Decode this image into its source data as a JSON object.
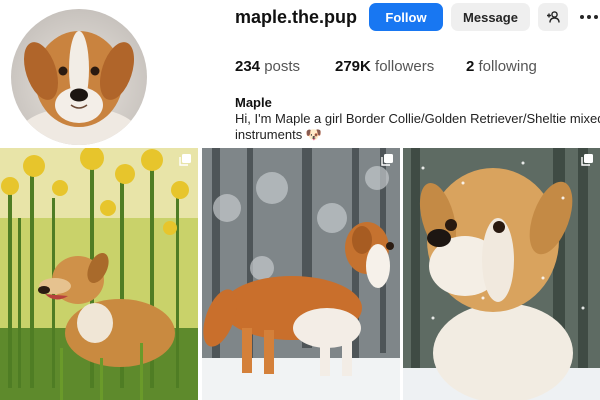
{
  "profile": {
    "username": "maple.the.pup",
    "display_name": "Maple",
    "bio_line1": "Hi, I'm Maple a girl Border Collie/Golden Retriever/Sheltie mixed",
    "bio_line2": "instruments 🐶",
    "avatar_icon": "dog-portrait-icon"
  },
  "actions": {
    "follow_label": "Follow",
    "message_label": "Message",
    "suggest_icon": "add-person-icon",
    "more_icon": "more-options-icon"
  },
  "stats": {
    "posts_count": "234",
    "posts_label": "posts",
    "followers_count": "279K",
    "followers_label": "followers",
    "following_count": "2",
    "following_label": "following"
  },
  "posts": [
    {
      "subject": "dog in tall yellow flowers",
      "multi_icon": "multiple-photos-icon"
    },
    {
      "subject": "dog standing in snow",
      "multi_icon": "multiple-photos-icon"
    },
    {
      "subject": "snowy dog close-up",
      "multi_icon": "multiple-photos-icon"
    }
  ],
  "colors": {
    "follow_button": "#1877f2",
    "secondary_button": "#efefef"
  }
}
